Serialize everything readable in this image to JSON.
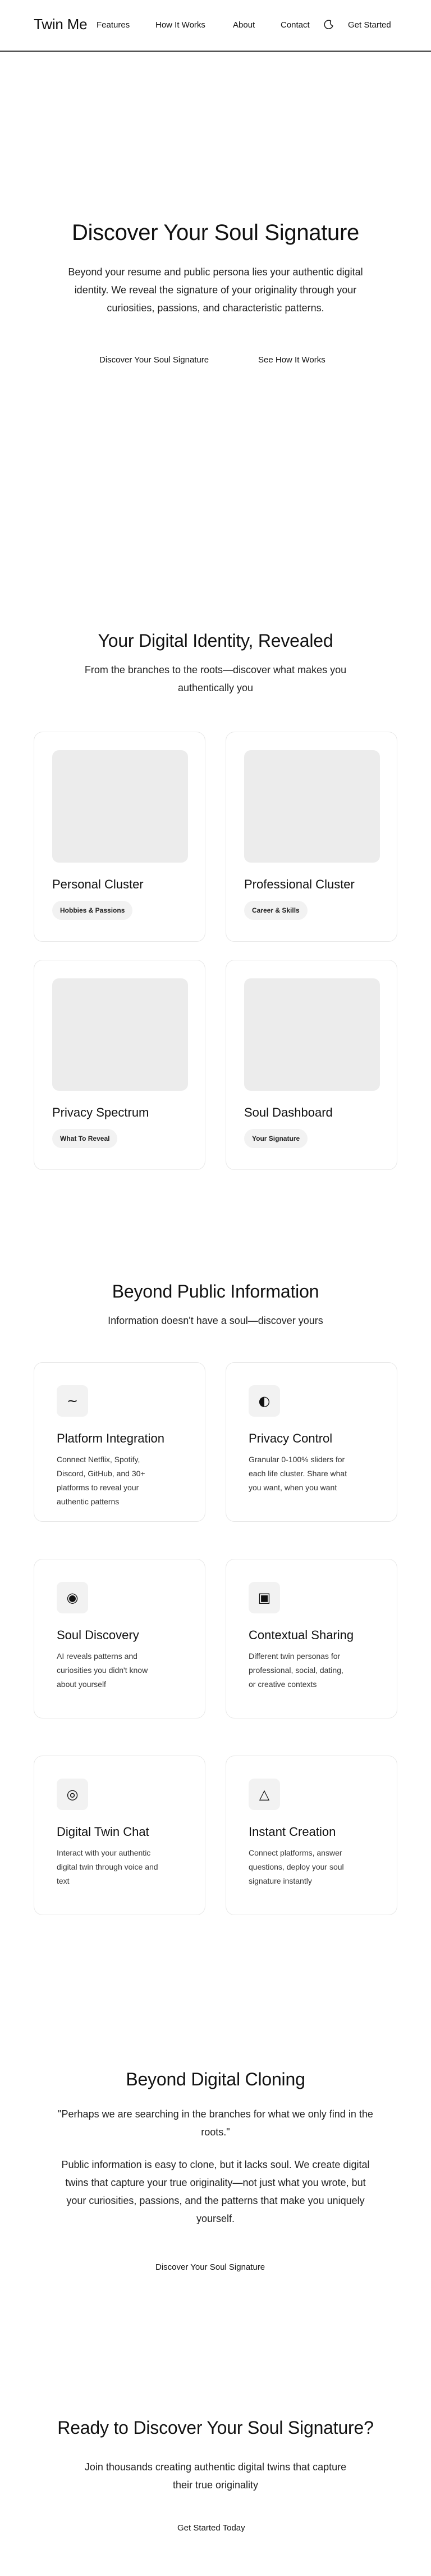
{
  "header": {
    "logo": "Twin Me",
    "nav": [
      "Features",
      "How It Works",
      "About",
      "Contact"
    ],
    "cta": "Get Started"
  },
  "hero": {
    "title": "Discover Your Soul Signature",
    "subtitle_lines": [
      "Beyond your resume and public persona lies your authentic digital",
      "identity. We reveal the signature of your originality through your",
      "curiosities, passions, and characteristic patterns."
    ],
    "primary_cta": "Discover Your Soul Signature",
    "secondary_cta": "See How It Works"
  },
  "identity": {
    "title": "Your Digital Identity, Revealed",
    "subtitle_lines": [
      "From the branches to the roots—discover what makes you",
      "authentically you"
    ],
    "cards": [
      {
        "title": "Personal Cluster",
        "tag": "Hobbies & Passions"
      },
      {
        "title": "Professional Cluster",
        "tag": "Career & Skills"
      },
      {
        "title": "Privacy Spectrum",
        "tag": "What To Reveal"
      },
      {
        "title": "Soul Dashboard",
        "tag": "Your Signature"
      }
    ]
  },
  "features": {
    "title": "Beyond Public Information",
    "subtitle": "Information doesn't have a soul—discover yours",
    "cards": [
      {
        "icon": "wave-icon",
        "glyph": "~",
        "title": "Platform Integration",
        "desc_lines": [
          "Connect Netflix, Spotify,",
          "Discord, GitHub, and 30+",
          "platforms to reveal your",
          "authentic patterns"
        ]
      },
      {
        "icon": "half-circle-icon",
        "glyph": "◐",
        "title": "Privacy Control",
        "desc_lines": [
          "Granular 0-100% sliders for",
          "each life cluster. Share what",
          "you want, when you want"
        ]
      },
      {
        "icon": "fisheye-icon",
        "glyph": "◉",
        "title": "Soul Discovery",
        "desc_lines": [
          "AI reveals patterns and",
          "curiosities you didn't know",
          "about yourself"
        ]
      },
      {
        "icon": "square-in-square-icon",
        "glyph": "▣",
        "title": "Contextual Sharing",
        "desc_lines": [
          "Different twin personas for",
          "professional, social, dating,",
          "or creative contexts"
        ]
      },
      {
        "icon": "bullseye-icon",
        "glyph": "◎",
        "title": "Digital Twin Chat",
        "desc_lines": [
          "Interact with your authentic",
          "digital twin through voice and",
          "text"
        ]
      },
      {
        "icon": "triangle-icon",
        "glyph": "△",
        "title": "Instant Creation",
        "desc_lines": [
          "Connect platforms, answer",
          "questions, deploy your soul",
          "signature instantly"
        ]
      }
    ]
  },
  "cloning": {
    "title": "Beyond Digital Cloning",
    "quote_lines": [
      "\"Perhaps we are searching in the branches for what we only find in the",
      "roots.\""
    ],
    "body_lines": [
      "Public information is easy to clone, but it lacks soul. We create digital",
      "twins that capture your true originality—not just what you wrote, but",
      "your curiosities, passions, and the patterns that make you uniquely",
      "yourself."
    ],
    "cta": "Discover Your Soul Signature"
  },
  "final_cta": {
    "title": "Ready to Discover Your Soul Signature?",
    "subtitle_lines": [
      "Join thousands creating authentic digital twins that capture",
      "their true originality"
    ],
    "cta": "Get Started Today"
  }
}
